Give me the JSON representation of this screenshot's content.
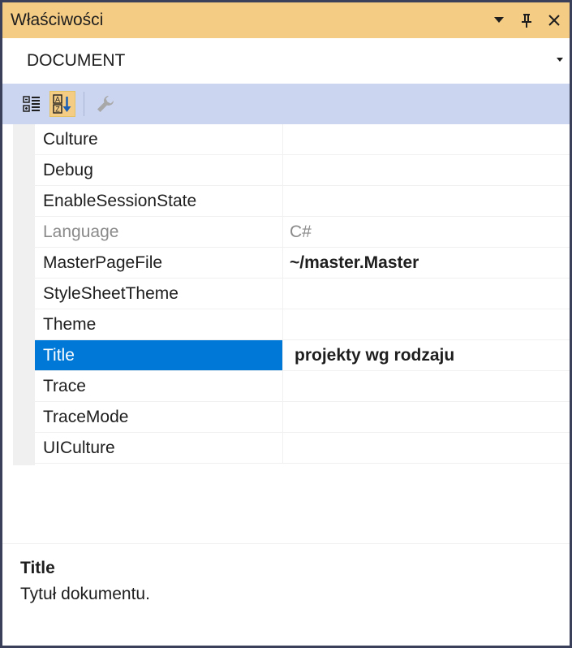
{
  "panel": {
    "title": "Właściwości",
    "controls": {
      "dropdown_icon": "triangle-down-icon",
      "pin_icon": "pin-icon",
      "close_icon": "close-icon"
    }
  },
  "object_selector": {
    "value": "DOCUMENT"
  },
  "toolbar": {
    "buttons": [
      {
        "name": "categorized",
        "icon": "categorized-icon",
        "active": false
      },
      {
        "name": "alphabetical",
        "icon": "sort-az-icon",
        "active": true
      },
      {
        "name": "property-pages",
        "icon": "wrench-icon",
        "active": false
      }
    ]
  },
  "properties": [
    {
      "name": "Culture",
      "value": ""
    },
    {
      "name": "Debug",
      "value": ""
    },
    {
      "name": "EnableSessionState",
      "value": ""
    },
    {
      "name": "Language",
      "value": "C#"
    },
    {
      "name": "MasterPageFile",
      "value": "~/master.Master"
    },
    {
      "name": "StyleSheetTheme",
      "value": ""
    },
    {
      "name": "Theme",
      "value": ""
    },
    {
      "name": "Title",
      "value": "projekty wg rodzaju"
    },
    {
      "name": "Trace",
      "value": ""
    },
    {
      "name": "TraceMode",
      "value": ""
    },
    {
      "name": "UICulture",
      "value": ""
    }
  ],
  "description": {
    "title": "Title",
    "text": "Tytuł dokumentu."
  },
  "colors": {
    "title_bar": "#f5cc84",
    "toolbar": "#ccd5f0",
    "selection": "#0078d7",
    "border": "#3a3f5a"
  }
}
